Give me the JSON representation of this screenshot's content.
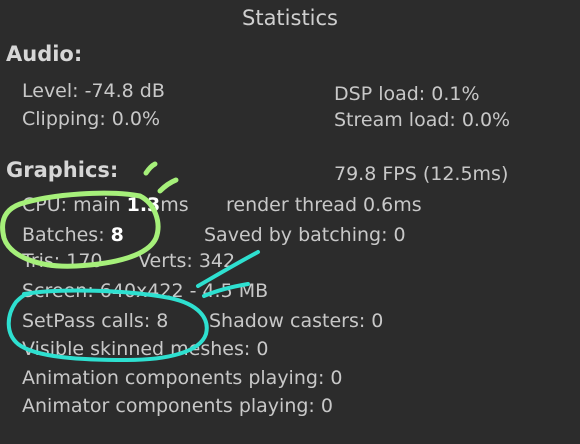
{
  "window": {
    "title": "Statistics"
  },
  "audio": {
    "heading": "Audio:",
    "level": "Level: -74.8 dB",
    "dsp_load": "DSP load: 0.1%",
    "clipping": "Clipping: 0.0%",
    "stream_load": "Stream load: 0.0%"
  },
  "graphics": {
    "heading": "Graphics:",
    "fps": "79.8 FPS (12.5ms)",
    "cpu_label": "CPU: main",
    "cpu_value": "1.3",
    "cpu_unit": "ms",
    "render_thread": "render thread 0.6ms",
    "batches_label": "Batches:",
    "batches_value": "8",
    "saved_by_batching": "Saved by batching: 0",
    "tris": "Tris: 170",
    "verts": "Verts: 342",
    "screen": "Screen: 640x422 - 4.5 MB",
    "setpass": "SetPass calls: 8",
    "shadow_casters": "Shadow casters: 0",
    "visible_skinned_meshes": "Visible skinned meshes: 0",
    "animation_components": "Animation components playing: 0",
    "animator_components": "Animator components playing: 0"
  },
  "annotations": {
    "green": "#a6f07a",
    "cyan": "#2ee0d0"
  }
}
